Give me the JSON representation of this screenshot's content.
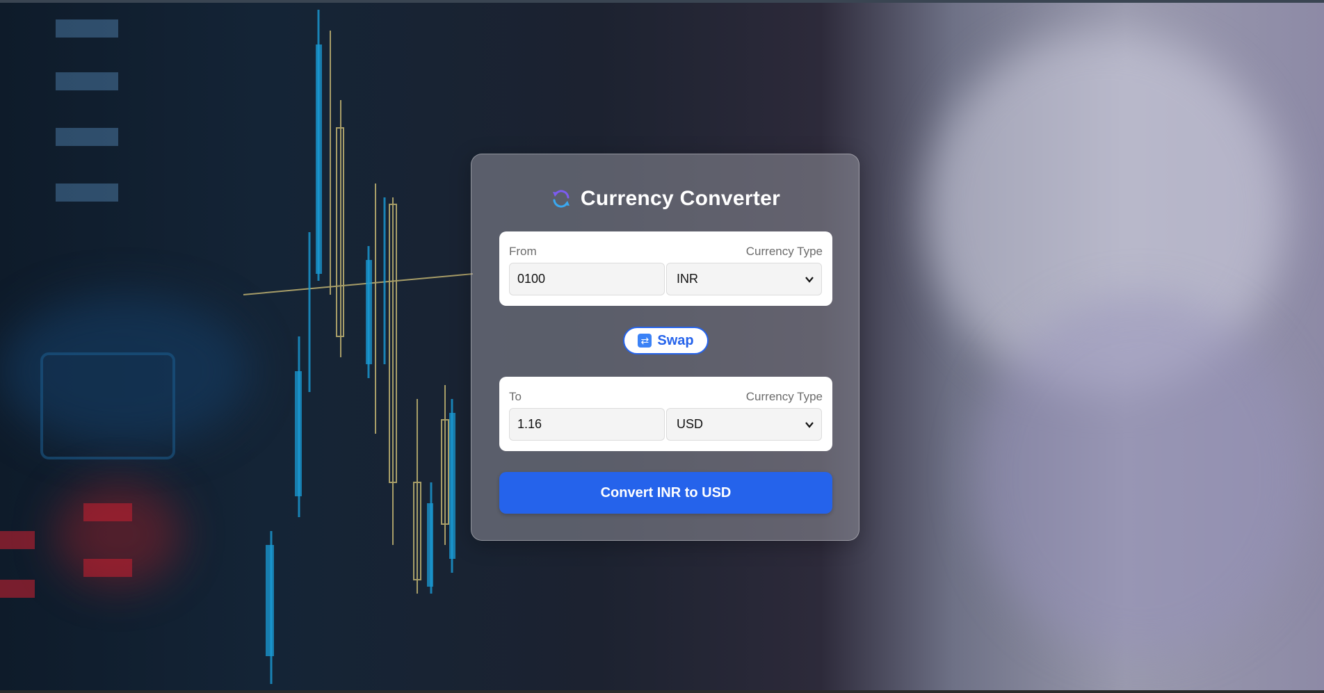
{
  "app": {
    "title": "Currency Converter",
    "logo_icon": "refresh-arrows-icon"
  },
  "from_section": {
    "label": "From",
    "currency_label": "Currency Type",
    "amount_value": "0100",
    "currency_value": "INR"
  },
  "swap": {
    "label": "Swap",
    "icon": "swap-icon"
  },
  "to_section": {
    "label": "To",
    "currency_label": "Currency Type",
    "amount_value": "1.16",
    "currency_value": "USD"
  },
  "convert_button": {
    "label": "Convert INR to USD"
  },
  "colors": {
    "accent": "#2563eb",
    "card_text": "#ffffff",
    "background_dark": "#0e1b2a",
    "background_light": "#9a9aae"
  },
  "background": {
    "description_icon": "stock-candlestick-chart-background"
  }
}
